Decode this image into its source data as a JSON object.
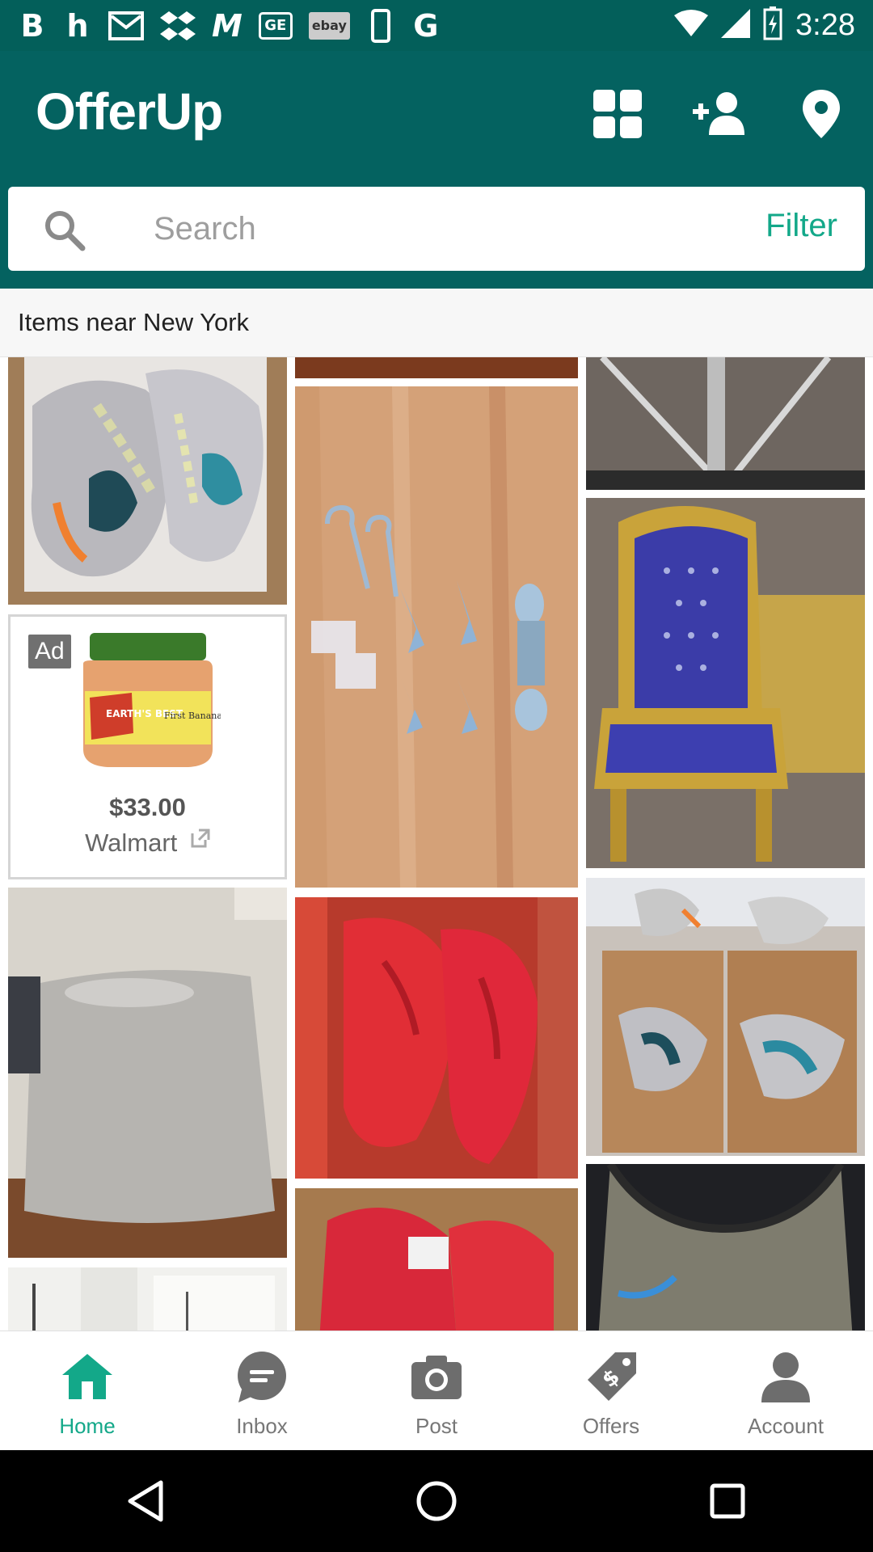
{
  "status_bar": {
    "time": "3:28",
    "notification_icons": [
      "b-icon",
      "h-icon",
      "mail-icon",
      "dropbox-icon",
      "m-icon",
      "ge-icon",
      "ebay-icon",
      "phone-icon",
      "g-icon"
    ],
    "ebay_label": "ebay",
    "ge_label": "GE"
  },
  "header": {
    "logo": "OfferUp"
  },
  "search": {
    "placeholder": "Search",
    "filter_label": "Filter"
  },
  "section": {
    "title": "Items near New York"
  },
  "ad": {
    "badge": "Ad",
    "price": "$33.00",
    "store": "Walmart",
    "product_text": "EARTH'S BEST",
    "product_sub": "First Bananas"
  },
  "items": [
    {
      "name": "sneakers-yeezy"
    },
    {
      "name": "wood-strip"
    },
    {
      "name": "metal-frame"
    },
    {
      "name": "hooks-knobs"
    },
    {
      "name": "throne-chair"
    },
    {
      "name": "mattress"
    },
    {
      "name": "red-sneakers"
    },
    {
      "name": "yeezy-boxes"
    },
    {
      "name": "red-sneakers-2"
    },
    {
      "name": "paper-item"
    },
    {
      "name": "tank-top"
    }
  ],
  "bottom_nav": [
    {
      "label": "Home",
      "active": true
    },
    {
      "label": "Inbox",
      "active": false
    },
    {
      "label": "Post",
      "active": false
    },
    {
      "label": "Offers",
      "active": false
    },
    {
      "label": "Account",
      "active": false
    }
  ],
  "colors": {
    "brand": "#046260",
    "status_bar": "#035f5a",
    "accent": "#13a889"
  }
}
